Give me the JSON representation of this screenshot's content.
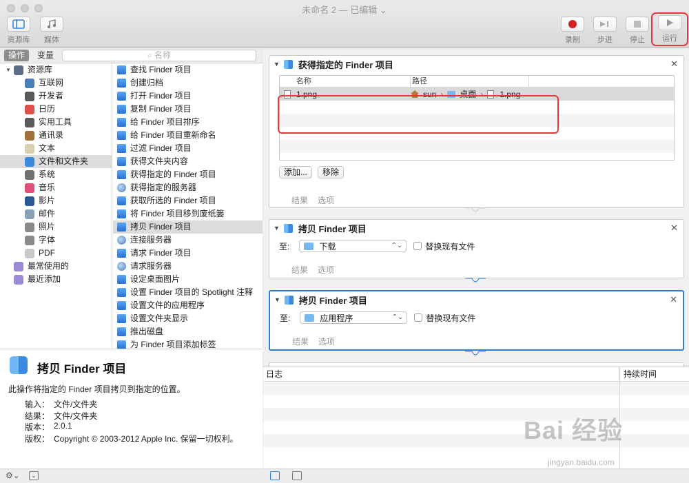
{
  "window": {
    "title": "未命名 2 — 已编辑 ⌄"
  },
  "toolbar": {
    "library_label": "资源库",
    "media_label": "媒体",
    "record_label": "录制",
    "step_label": "步进",
    "stop_label": "停止",
    "run_label": "运行"
  },
  "library": {
    "tab_actions": "操作",
    "tab_variables": "变量",
    "search_placeholder": "名称",
    "categories": [
      {
        "label": "资源库",
        "icon": "library-icon",
        "color": "#5e6b85"
      },
      {
        "label": "互联网",
        "icon": "globe-icon",
        "color": "#4a7fb8"
      },
      {
        "label": "开发者",
        "icon": "tools-icon",
        "color": "#5a5a5a"
      },
      {
        "label": "日历",
        "icon": "calendar-icon",
        "color": "#e0504a"
      },
      {
        "label": "实用工具",
        "icon": "wrench-icon",
        "color": "#5a5a5a"
      },
      {
        "label": "通讯录",
        "icon": "contacts-icon",
        "color": "#a0703a"
      },
      {
        "label": "文本",
        "icon": "text-icon",
        "color": "#d8d0b0"
      },
      {
        "label": "文件和文件夹",
        "icon": "finder-icon",
        "color": "#3a8ae0"
      },
      {
        "label": "系统",
        "icon": "system-icon",
        "color": "#707070"
      },
      {
        "label": "音乐",
        "icon": "music-icon",
        "color": "#e0507a"
      },
      {
        "label": "影片",
        "icon": "movie-icon",
        "color": "#2a5a9a"
      },
      {
        "label": "邮件",
        "icon": "mail-icon",
        "color": "#8aa0b8"
      },
      {
        "label": "照片",
        "icon": "photos-icon",
        "color": "#8a8a8a"
      },
      {
        "label": "字体",
        "icon": "font-icon",
        "color": "#8a8a8a"
      },
      {
        "label": "PDF",
        "icon": "pdf-icon",
        "color": "#c8c8c8"
      },
      {
        "label": "最常使用的",
        "icon": "smart-folder-icon",
        "color": "#9a8ad8"
      },
      {
        "label": "最近添加",
        "icon": "smart-folder-icon",
        "color": "#9a8ad8"
      }
    ],
    "actions": [
      "查找 Finder 项目",
      "创建归档",
      "打开 Finder 项目",
      "复制 Finder 项目",
      "给 Finder 项目排序",
      "给 Finder 项目重新命名",
      "过滤 Finder 项目",
      "获得文件夹内容",
      "获得指定的 Finder 项目",
      "获得指定的服务器",
      "获取所选的 Finder 项目",
      "将 Finder 项目移到废纸篓",
      "拷贝 Finder 项目",
      "连接服务器",
      "请求 Finder 项目",
      "请求服务器",
      "设定桌面图片",
      "设置 Finder 项目的 Spotlight 注释",
      "设置文件的应用程序",
      "设置文件夹显示",
      "推出磁盘",
      "为 Finder 项目添加标签"
    ]
  },
  "description": {
    "title": "拷贝 Finder 项目",
    "summary": "此操作将指定的 Finder 项目拷贝到指定的位置。",
    "input_label": "输入：",
    "input_value": "文件/文件夹",
    "result_label": "结果：",
    "result_value": "文件/文件夹",
    "version_label": "版本：",
    "version_value": "2.0.1",
    "copyright_label": "版权：",
    "copyright_value": "Copyright © 2003-2012 Apple Inc.  保留一切权利。"
  },
  "workflow": {
    "card1": {
      "title": "获得指定的 Finder 项目",
      "col_name": "名称",
      "col_path": "路径",
      "row_name": "1.png",
      "path_home": "sun",
      "path_folder": "桌面",
      "path_file": "1.png",
      "add_button": "添加...",
      "remove_button": "移除",
      "results": "结果",
      "options": "选项"
    },
    "card2": {
      "title": "拷贝 Finder 项目",
      "to_label": "至:",
      "destination": "下载",
      "replace_label": "替换现有文件",
      "results": "结果",
      "options": "选项"
    },
    "card3": {
      "title": "拷贝 Finder 项目",
      "to_label": "至:",
      "destination": "应用程序",
      "replace_label": "替换现有文件",
      "results": "结果",
      "options": "选项"
    }
  },
  "log": {
    "col_log": "日志",
    "col_duration": "持续时间"
  },
  "watermark": {
    "main": "Bai 经验",
    "sub": "jingyan.baidu.com"
  }
}
